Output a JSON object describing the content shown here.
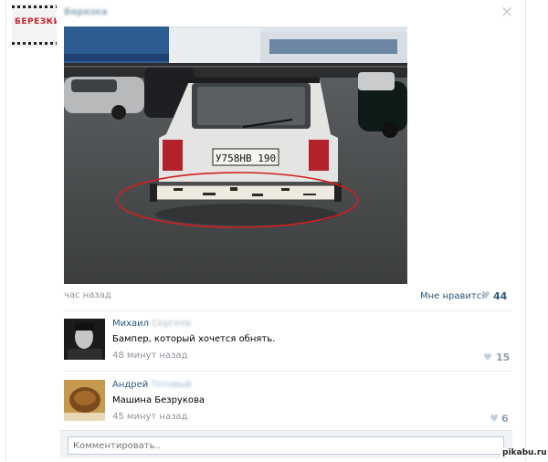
{
  "post": {
    "group_logo_text": "БЕРЕЗКИ",
    "group_name": "Березка",
    "close_glyph": "×",
    "photo_plate": "У758НВ 190",
    "timestamp": "час назад",
    "like_label": "Мне нравится",
    "like_count": "44"
  },
  "comments": [
    {
      "first_name": "Михаил",
      "surname_blurred": "Сергеев",
      "text": "Бампер, который хочется обнять.",
      "time": "48 минут назад",
      "likes": "15"
    },
    {
      "first_name": "Андрей",
      "surname_blurred": "Тотовый",
      "text": "Машина Безрукова",
      "time": "45 минут назад",
      "likes": "6"
    }
  ],
  "reply": {
    "placeholder": "Комментировать.."
  },
  "watermark": "pikabu.ru",
  "icons": {
    "heart": "♥",
    "close": "close-icon"
  },
  "colors": {
    "link": "#2b587a",
    "muted": "#8d949b",
    "highlight_ellipse": "#d11f1f"
  }
}
